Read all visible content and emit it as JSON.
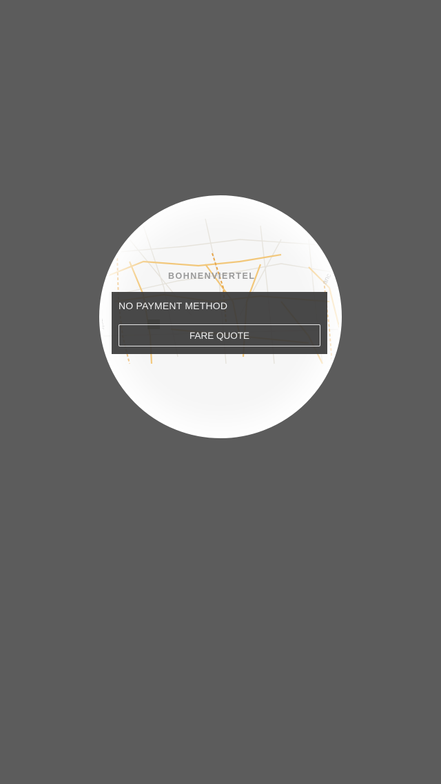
{
  "map": {
    "district_label": "BOHNENVIERTEL",
    "street_left": "enstr",
    "street_right": "anc"
  },
  "payment_panel": {
    "title": "NO PAYMENT METHOD",
    "button_label": "FARE QUOTE"
  },
  "colors": {
    "backdrop": "#5c5c5c",
    "ring": "#ffffff",
    "panel": "#3a3a3a",
    "car": "#6cc36a"
  }
}
